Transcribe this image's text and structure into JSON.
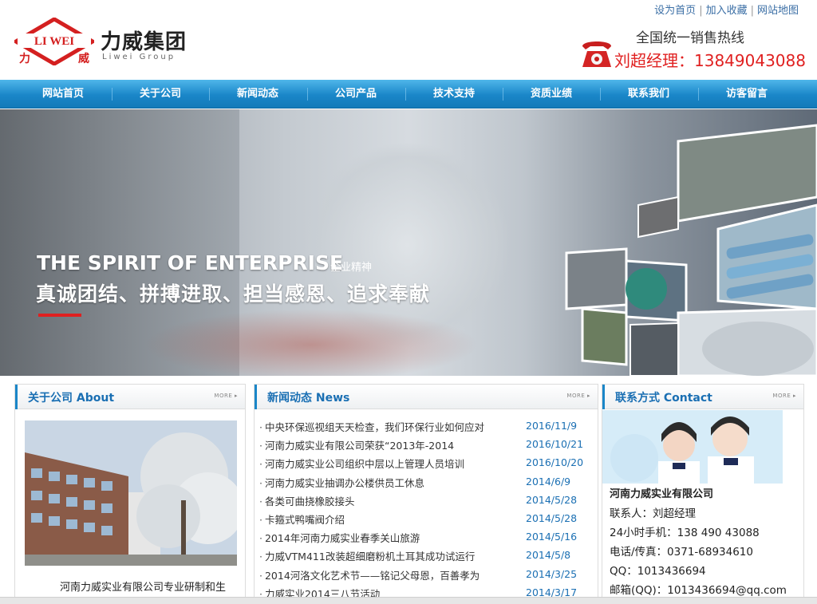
{
  "top_links": [
    "设为首页",
    "加入收藏",
    "网站地图"
  ],
  "logo": {
    "badge_text": "LI WEI",
    "badge_chars": [
      "力",
      "威"
    ],
    "title": "力威集团",
    "subtitle": "Liwei Group"
  },
  "hotline": {
    "title": "全国统一销售热线",
    "contact": "刘超经理：13849043088"
  },
  "nav": [
    "网站首页",
    "关于公司",
    "新闻动态",
    "公司产品",
    "技术支持",
    "资质业绩",
    "联系我们",
    "访客留言"
  ],
  "banner": {
    "heading_en": "THE SPIRIT OF ENTERPRISE",
    "heading_cn_small": "企业精神",
    "slogan": "真诚团结、拼搏进取、担当感恩、追求奉献"
  },
  "about": {
    "title": "关于公司 About",
    "more": "MORE",
    "text": "河南力威实业有限公司专业研制和生"
  },
  "news": {
    "title": "新闻动态 News",
    "more": "MORE",
    "items": [
      {
        "title": "中央环保巡视组天天检查，我们环保行业如何应对",
        "date": "2016/11/9"
      },
      {
        "title": "河南力威实业有限公司荣获“2013年-2014",
        "date": "2016/10/21"
      },
      {
        "title": "河南力威实业公司组织中层以上管理人员培训",
        "date": "2016/10/20"
      },
      {
        "title": "河南力威实业抽调办公楼供员工休息",
        "date": "2014/6/9"
      },
      {
        "title": "各类可曲挠橡胶接头",
        "date": "2014/5/28"
      },
      {
        "title": "卡箍式鸭嘴阀介绍",
        "date": "2014/5/28"
      },
      {
        "title": "2014年河南力威实业春季关山旅游",
        "date": "2014/5/16"
      },
      {
        "title": "力威VTM411改装超细磨粉机土耳其成功试运行",
        "date": "2014/5/8"
      },
      {
        "title": "2014河洛文化艺术节——铭记父母恩，百善孝为",
        "date": "2014/3/25"
      },
      {
        "title": "力威实业2014三八节活动",
        "date": "2014/3/17"
      }
    ]
  },
  "contact": {
    "title": "联系方式 Contact",
    "more": "MORE",
    "company": "河南力威实业有限公司",
    "lines": [
      "联系人：刘超经理",
      "24小时手机：138 490 43088",
      "电话/传真：0371-68934610",
      "QQ：1013436694",
      "邮箱(QQ)：1013436694@qq.com"
    ]
  },
  "colors": {
    "nav_blue": "#1a86c8",
    "accent_red": "#e02020",
    "link_blue": "#1a6fb3"
  }
}
